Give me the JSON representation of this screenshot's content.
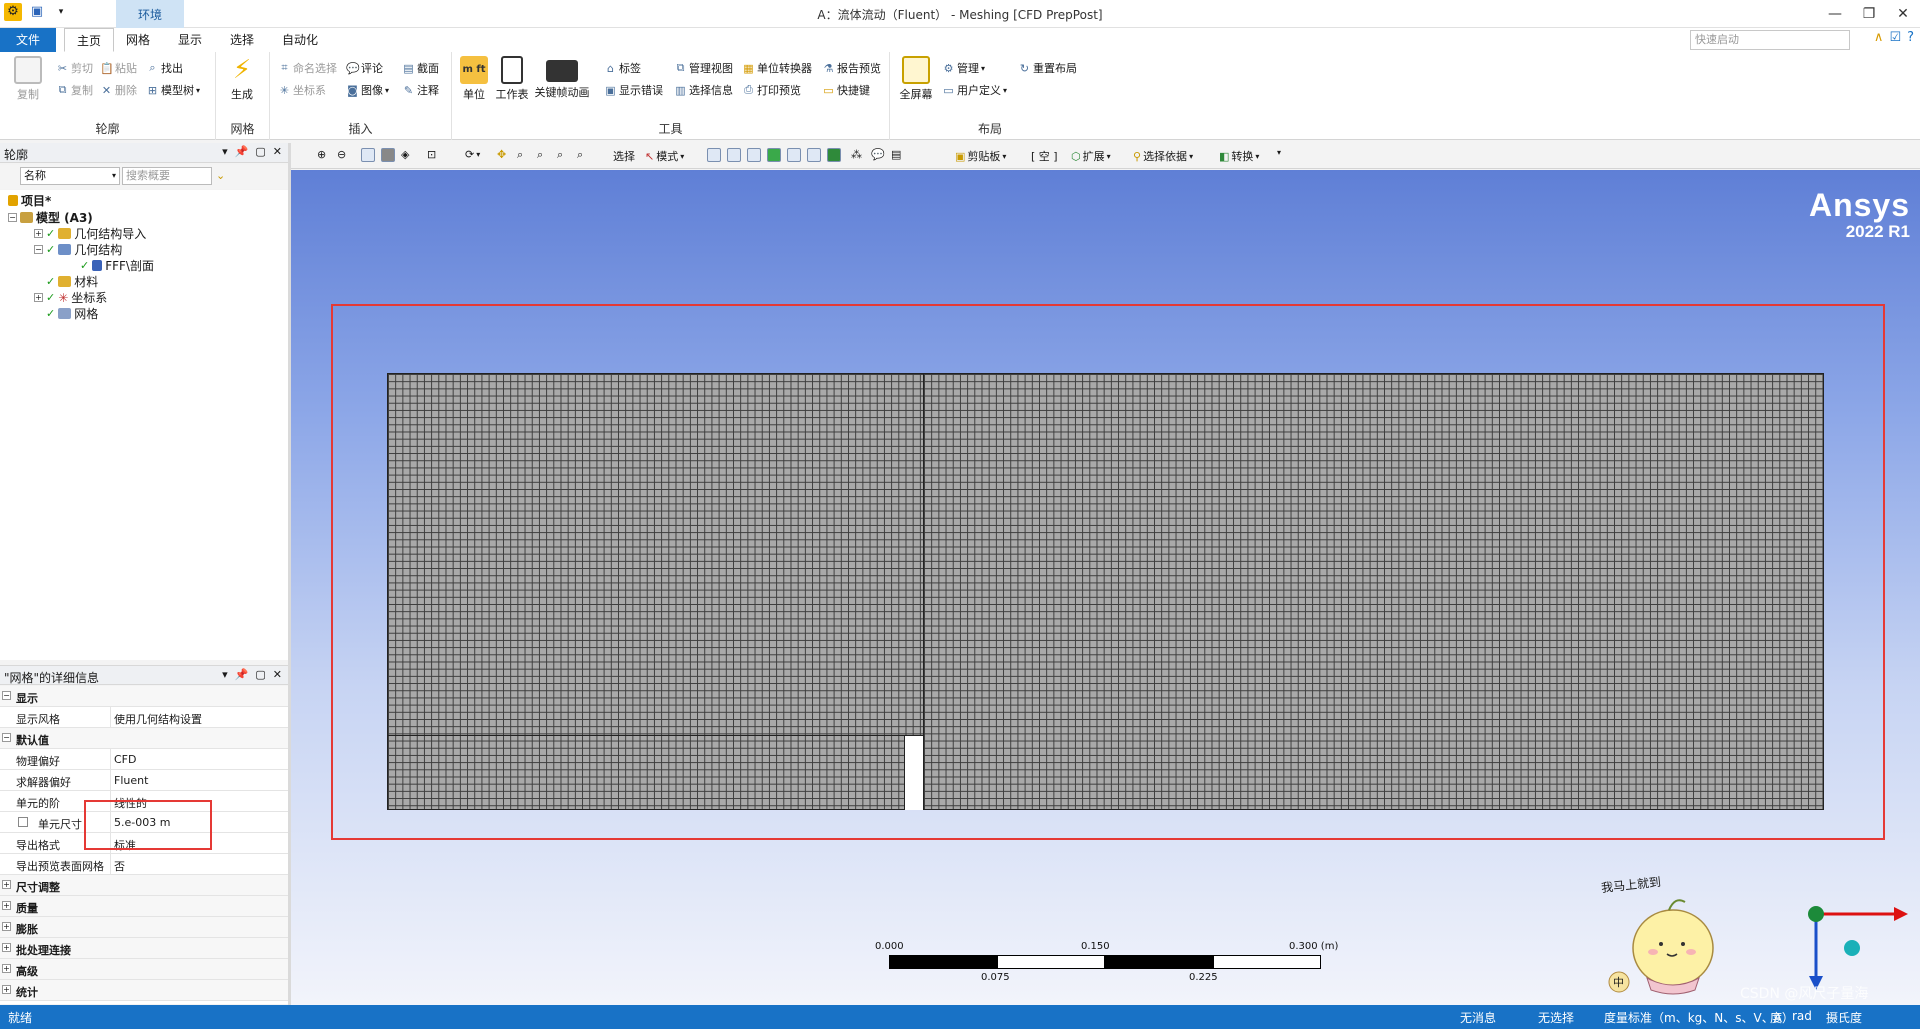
{
  "titlebar": {
    "context_tab": "环境",
    "title": "A：流体流动（Fluent） - Meshing [CFD PrepPost]",
    "min": "—",
    "restore": "❐",
    "close": "✕"
  },
  "tabs": {
    "file": "文件",
    "items": [
      "主页",
      "网格",
      "显示",
      "选择",
      "自动化"
    ],
    "quick_search_placeholder": "快速启动"
  },
  "ribbon": {
    "outline_group": {
      "label": "轮廓",
      "copy": "复制",
      "cut": "剪切",
      "paste": "粘贴",
      "find": "找出",
      "dup": "复制",
      "delete": "删除",
      "tree": "模型树"
    },
    "mesh_group": {
      "label": "网格",
      "generate": "生成"
    },
    "insert_group": {
      "label": "插入",
      "named_sel": "命名选择",
      "comment": "评论",
      "section": "截面",
      "coord": "坐标系",
      "image": "图像",
      "annotation": "注释"
    },
    "tools_group": {
      "label": "工具",
      "units": "单位",
      "worksheet": "工作表",
      "keyframe": "关键帧动画",
      "tag": "标签",
      "manage_view": "管理视图",
      "unit_conv": "单位转换器",
      "report_preview": "报告预览",
      "show_errors": "显示错误",
      "sel_info": "选择信息",
      "print_preview": "打印预览",
      "shortcut": "快捷键"
    },
    "layout_group": {
      "label": "布局",
      "fullscreen": "全屏幕",
      "manage": "管理",
      "reset_layout": "重置布局",
      "user_defined": "用户定义"
    }
  },
  "outline": {
    "title": "轮廓",
    "filter_name": "名称",
    "search_placeholder": "搜索概要",
    "tree": {
      "project": "项目*",
      "model": "模型 (A3)",
      "geom_import": "几何结构导入",
      "geometry": "几何结构",
      "body": "FFF\\剖面",
      "materials": "材料",
      "coords": "坐标系",
      "mesh": "网格"
    }
  },
  "details": {
    "title": "\"网格\"的详细信息",
    "rows": [
      {
        "k": "显示",
        "v": "",
        "cat": true,
        "pm": "−"
      },
      {
        "k": "显示风格",
        "v": "使用几何结构设置"
      },
      {
        "k": "默认值",
        "v": "",
        "cat": true,
        "pm": "−"
      },
      {
        "k": "物理偏好",
        "v": "CFD"
      },
      {
        "k": "求解器偏好",
        "v": "Fluent"
      },
      {
        "k": "单元的阶",
        "v": "线性的"
      },
      {
        "k": "单元尺寸",
        "v": "5.e-003 m",
        "box": true
      },
      {
        "k": "导出格式",
        "v": "标准"
      },
      {
        "k": "导出预览表面网格",
        "v": "否"
      },
      {
        "k": "尺寸调整",
        "v": "",
        "cat": true,
        "pm": "+"
      },
      {
        "k": "质量",
        "v": "",
        "cat": true,
        "pm": "+"
      },
      {
        "k": "膨胀",
        "v": "",
        "cat": true,
        "pm": "+"
      },
      {
        "k": "批处理连接",
        "v": "",
        "cat": true,
        "pm": "+"
      },
      {
        "k": "高级",
        "v": "",
        "cat": true,
        "pm": "+"
      },
      {
        "k": "统计",
        "v": "",
        "cat": true,
        "pm": "+"
      }
    ]
  },
  "viewtool": {
    "select": "选择",
    "mode": "模式",
    "clipboard": "剪贴板",
    "empty": "[ 空 ]",
    "extend": "扩展",
    "select_by": "选择依据",
    "convert": "转换"
  },
  "viewport": {
    "brand": "Ansys",
    "version": "2022 R1",
    "scale": {
      "t0": "0.000",
      "t1": "0.150",
      "t2": "0.300 (m)",
      "b1": "0.075",
      "b2": "0.225"
    },
    "mascot_text": "我马上就到",
    "mascot_ime": "中"
  },
  "status": {
    "ready": "就绪",
    "messages": "无消息",
    "selection": "无选择",
    "units": "度量标准（m、kg、N、s、V、A）",
    "deg": "度",
    "rad": "rad",
    "temp": "摄氏度",
    "watermark": "CSDN @风尺子量海"
  }
}
